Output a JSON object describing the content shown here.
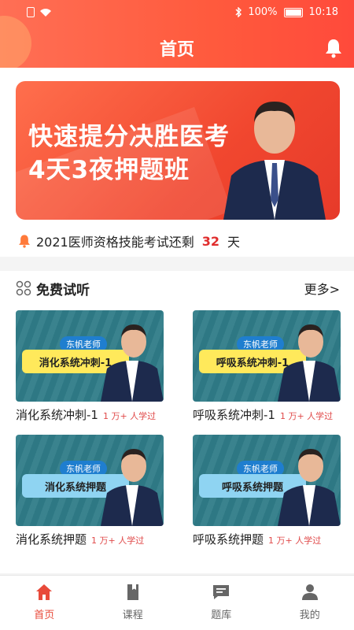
{
  "status_bar": {
    "battery": "100%",
    "time": "10:18"
  },
  "header": {
    "title": "首页"
  },
  "banner": {
    "line1": "快速提分决胜医考",
    "line2": "4天3夜押题班"
  },
  "countdown": {
    "prefix": "2021医师资格技能考试还剩",
    "days": "32",
    "suffix": "天"
  },
  "free_trial": {
    "title": "免费试听",
    "more": "更多>",
    "items": [
      {
        "tag": "东帆老师",
        "subject": "消化系统冲刺-1",
        "name": "消化系统冲刺-1",
        "meta": "1 万+ 人学过"
      },
      {
        "tag": "东帆老师",
        "subject": "呼吸系统冲刺-1",
        "name": "呼吸系统冲刺-1",
        "meta": "1 万+ 人学过"
      },
      {
        "tag": "东帆老师",
        "subject": "消化系统押题",
        "name": "消化系统押题",
        "meta": "1 万+ 人学过"
      },
      {
        "tag": "东帆老师",
        "subject": "呼吸系统押题",
        "name": "呼吸系统押题",
        "meta": "1 万+ 人学过"
      }
    ]
  },
  "tabs": [
    {
      "label": "首页",
      "icon": "home-icon"
    },
    {
      "label": "课程",
      "icon": "book-icon"
    },
    {
      "label": "题库",
      "icon": "question-bank-icon"
    },
    {
      "label": "我的",
      "icon": "user-icon"
    }
  ],
  "colors": {
    "accent": "#e84a3a",
    "header": "#ff5a3d",
    "thumb_bg": "#2f7c88",
    "tag_bg": "#1f7ecf",
    "subject_yellow": "#ffe95b",
    "subject_blue": "#8fd4f2"
  }
}
